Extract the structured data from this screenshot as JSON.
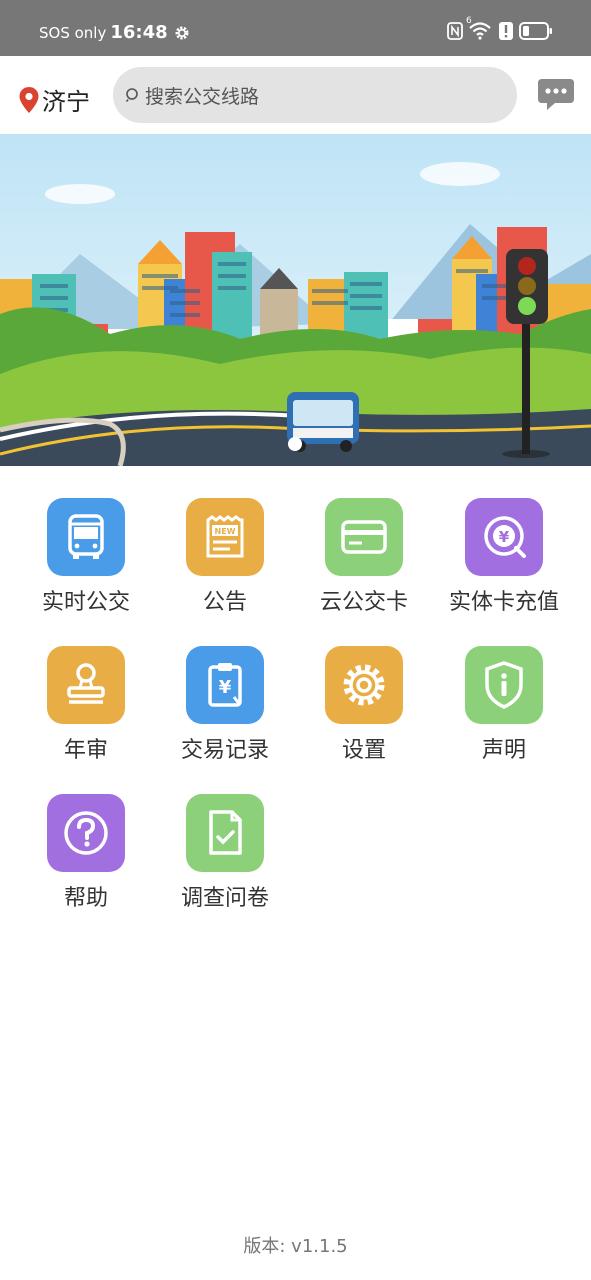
{
  "status_bar": {
    "carrier": "SOS only",
    "time": "16:48",
    "icons": [
      "gear-icon",
      "nfc-icon",
      "wifi-icon",
      "alert-icon",
      "battery-icon"
    ],
    "wifi_badge": "6"
  },
  "header": {
    "city": "济宁",
    "search_placeholder": "搜索公交线路",
    "icons": [
      "location-pin-icon",
      "search-icon",
      "message-icon"
    ]
  },
  "banner": {
    "description_icon": "city-bus-traffic-light-illustration"
  },
  "menu": {
    "items": [
      {
        "label": "实时公交",
        "icon": "bus-icon",
        "color": "#4a9be8"
      },
      {
        "label": "公告",
        "icon": "news-icon",
        "color": "#e9ad45"
      },
      {
        "label": "云公交卡",
        "icon": "card-icon",
        "color": "#8dd07a"
      },
      {
        "label": "实体卡充值",
        "icon": "yen-recharge-icon",
        "color": "#a16fe0"
      },
      {
        "label": "年审",
        "icon": "stamp-icon",
        "color": "#e9ad45"
      },
      {
        "label": "交易记录",
        "icon": "receipt-icon",
        "color": "#4a9be8"
      },
      {
        "label": "设置",
        "icon": "gear-icon",
        "color": "#e9ad45"
      },
      {
        "label": "声明",
        "icon": "shield-info-icon",
        "color": "#8dd07a"
      },
      {
        "label": "帮助",
        "icon": "help-icon",
        "color": "#a16fe0"
      },
      {
        "label": "调查问卷",
        "icon": "survey-icon",
        "color": "#8dd07a"
      }
    ]
  },
  "footer": {
    "version": "版本: v1.1.5"
  }
}
